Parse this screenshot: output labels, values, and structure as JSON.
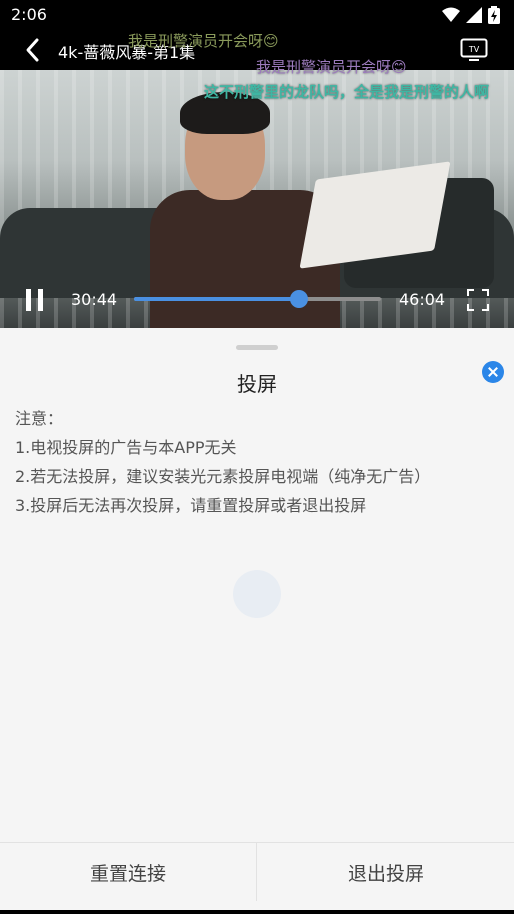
{
  "status_bar": {
    "time": "2:06",
    "icons": [
      "wifi-icon",
      "signal-icon",
      "battery-icon"
    ]
  },
  "player": {
    "title": "4k-蔷薇风暴-第1集",
    "current_time": "30:44",
    "total_time": "46:04",
    "progress_fraction": 0.667,
    "accent_color": "#4a90e2",
    "icons": [
      "back-arrow-icon",
      "tv-cast-icon",
      "pause-icon",
      "fullscreen-icon"
    ]
  },
  "danmaku": [
    {
      "text": "我是刑警演员开会呀😊",
      "color": "#8a9a5b"
    },
    {
      "text": "我是刑警演员开会呀😊",
      "color": "#9c7bbd"
    },
    {
      "text": "这不刑警里的龙队吗，全是我是刑警的人啊",
      "color": "#3fb6a3"
    }
  ],
  "cast_sheet": {
    "title": "投屏",
    "notes": [
      "注意：",
      "1.电视投屏的广告与本APP无关",
      "2.若无法投屏，建议安装光元素投屏电视端（纯净无广告）",
      "3.投屏后无法再次投屏，请重置投屏或者退出投屏"
    ],
    "close_color": "#2b86e8",
    "buttons": {
      "reset": "重置连接",
      "exit": "退出投屏"
    }
  }
}
